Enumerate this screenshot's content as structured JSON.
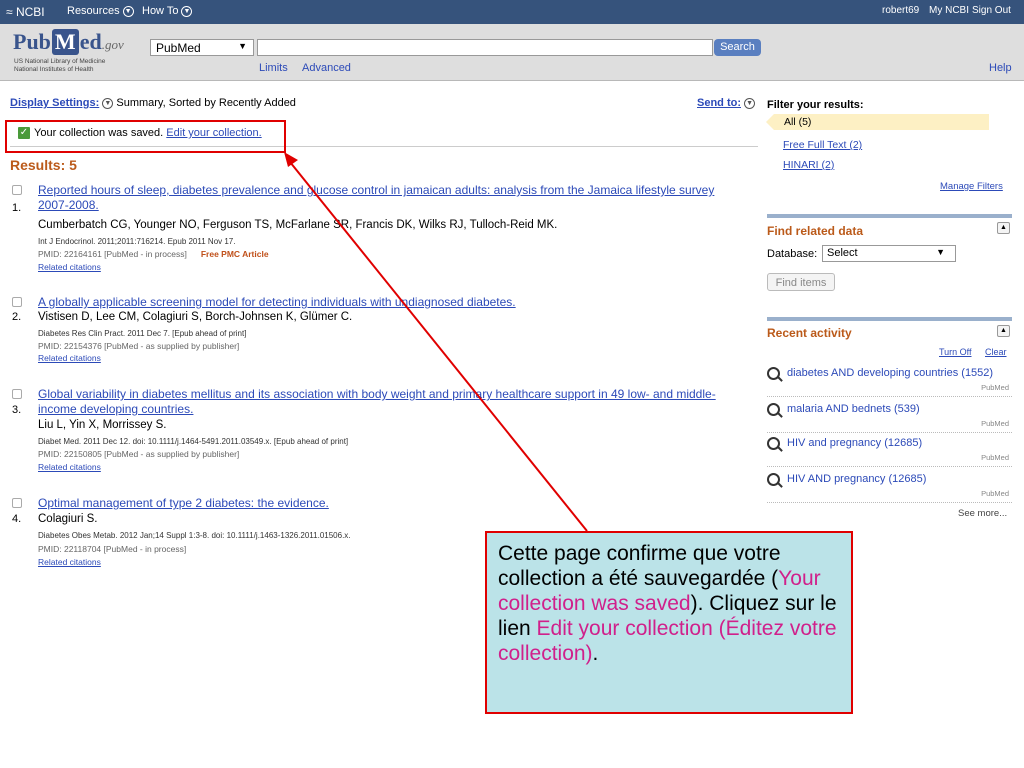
{
  "ncbi_bar": {
    "logo_label": "NCBI",
    "resources_label": "Resources",
    "howto_label": "How To",
    "username": "robert69",
    "my_ncbi_label": "My NCBI",
    "sign_out_label": "Sign Out"
  },
  "header": {
    "logo_pub": "Pub",
    "logo_m": "M",
    "logo_ed": "ed",
    "logo_gov": ".gov",
    "library_line1": "US National Library of Medicine",
    "library_line2": "National Institutes of Health",
    "db_selected": "PubMed",
    "search_value": "",
    "search_button_label": "Search",
    "limits_label": "Limits",
    "advanced_label": "Advanced",
    "help_label": "Help"
  },
  "toolbar": {
    "display_settings_label": "Display Settings:",
    "display_settings_value": "Summary, Sorted by Recently Added",
    "send_to_label": "Send to:"
  },
  "message": {
    "saved_text": "Your collection was saved.",
    "edit_link": "Edit your collection."
  },
  "results_count": "Results: 5",
  "results": [
    {
      "number": "1.",
      "title": "Reported hours of sleep, diabetes prevalence and glucose control in jamaican adults: analysis from the Jamaica lifestyle survey 2007-2008.",
      "authors": "Cumberbatch CG, Younger NO, Ferguson TS, McFarlane SR, Francis DK, Wilks RJ, Tulloch-Reid MK.",
      "journal": "Int J Endocrinol. 2011;2011:716214. Epub 2011 Nov 17.",
      "pmid": "PMID: 22164161 [PubMed - in process]",
      "pmc": "Free PMC Article",
      "related": "Related citations"
    },
    {
      "number": "2.",
      "title": "A globally applicable screening model for detecting individuals with undiagnosed diabetes.",
      "authors": "Vistisen D, Lee CM, Colagiuri S, Borch-Johnsen K, Glümer C.",
      "journal": "Diabetes Res Clin Pract. 2011 Dec 7. [Epub ahead of print]",
      "pmid": "PMID: 22154376 [PubMed - as supplied by publisher]",
      "related": "Related citations"
    },
    {
      "number": "3.",
      "title": "Global variability in diabetes mellitus and its association with body weight and primary healthcare support in 49 low- and middle-income developing countries.",
      "authors": "Liu L, Yin X, Morrissey S.",
      "journal": "Diabet Med. 2011 Dec 12. doi: 10.1111/j.1464-5491.2011.03549.x. [Epub ahead of print]",
      "pmid": "PMID: 22150805 [PubMed - as supplied by publisher]",
      "related": "Related citations"
    },
    {
      "number": "4.",
      "title": "Optimal management of type 2 diabetes: the evidence.",
      "authors": "Colagiuri S.",
      "journal": "Diabetes Obes Metab. 2012 Jan;14 Suppl 1:3-8. doi: 10.1111/j.1463-1326.2011.01506.x.",
      "pmid": "PMID: 22118704 [PubMed - in process]",
      "related": "Related citations"
    }
  ],
  "sidebar": {
    "filter_title": "Filter your results:",
    "filters": [
      "All (5)",
      "Free Full Text (2)",
      "HINARI (2)"
    ],
    "manage_filters": "Manage Filters",
    "find_related_title": "Find related data",
    "database_label": "Database:",
    "database_selected": "Select",
    "find_items_label": "Find items",
    "recent_activity_title": "Recent activity",
    "turn_off_label": "Turn Off",
    "clear_label": "Clear",
    "activity": [
      {
        "text": "diabetes AND developing countries (1552)",
        "source": "PubMed"
      },
      {
        "text": "malaria AND bednets (539)",
        "source": "PubMed"
      },
      {
        "text": "HIV and pregnancy (12685)",
        "source": "PubMed"
      },
      {
        "text": "HIV AND pregnancy (12685)",
        "source": "PubMed"
      }
    ],
    "see_more": "See more..."
  },
  "callout": {
    "part1": "Cette page confirme que votre collection a été sauvegardée (",
    "highlight1": "Your collection was saved",
    "part2": "). Cliquez sur le lien ",
    "highlight2": "Edit your collection (Éditez votre collection)",
    "part3": "."
  },
  "colors": {
    "ncbi_bar": "#36537c",
    "link": "#2c4ab8",
    "results_heading": "#bb5a1a",
    "annotation_red": "#e00000",
    "callout_bg": "#bbe3e8",
    "callout_highlight": "#d0208b"
  }
}
